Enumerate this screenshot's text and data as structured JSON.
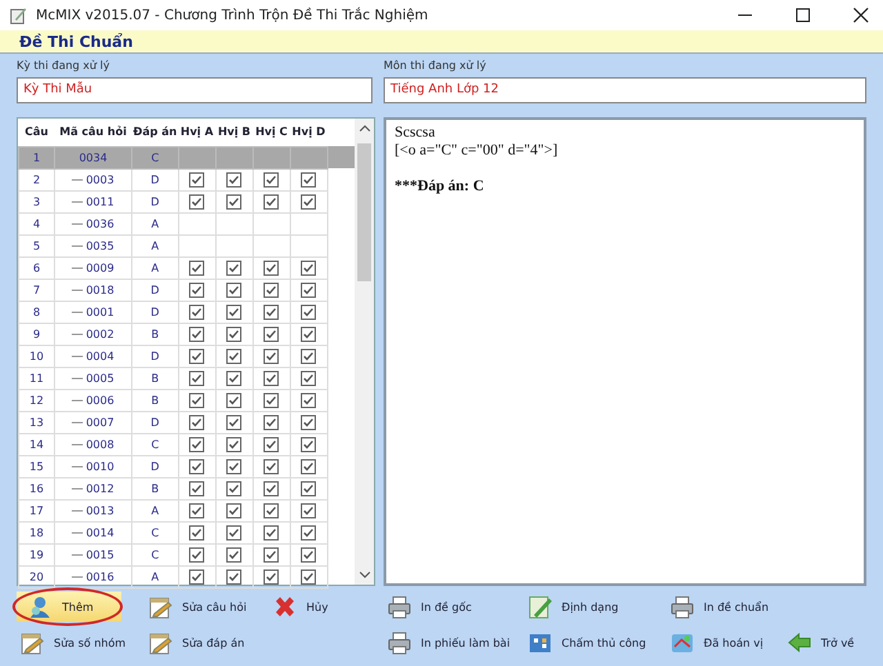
{
  "window": {
    "title": "McMIX v2015.07 - Chương Trình Trộn Đề Thi Trắc Nghiệm"
  },
  "header": {
    "title": "Đề Thi Chuẩn"
  },
  "fields": [
    {
      "label": "Kỳ thi đang xử lý",
      "value": "Kỳ Thi Mẫu"
    },
    {
      "label": "Môn thi đang xử lý",
      "value": "Tiếng Anh Lớp 12"
    }
  ],
  "table": {
    "columns": [
      "Câu",
      "Mã câu hỏi",
      "Đáp án",
      "Hvị A",
      "Hvị B",
      "Hvị C",
      "Hvị D"
    ],
    "rows": [
      {
        "no": "1",
        "code": "0034",
        "answer": "C",
        "selected": true
      },
      {
        "no": "2",
        "code": "0003",
        "answer": "D",
        "selected": false,
        "checks": [
          true,
          true,
          true,
          true
        ]
      },
      {
        "no": "3",
        "code": "0011",
        "answer": "D",
        "selected": false,
        "checks": [
          true,
          true,
          true,
          true
        ]
      },
      {
        "no": "4",
        "code": "0036",
        "answer": "A",
        "selected": false
      },
      {
        "no": "5",
        "code": "0035",
        "answer": "A",
        "selected": false
      },
      {
        "no": "6",
        "code": "0009",
        "answer": "A",
        "selected": false,
        "checks": [
          true,
          true,
          true,
          true
        ]
      },
      {
        "no": "7",
        "code": "0018",
        "answer": "D",
        "selected": false,
        "checks": [
          true,
          true,
          true,
          true
        ]
      },
      {
        "no": "8",
        "code": "0001",
        "answer": "D",
        "selected": false,
        "checks": [
          true,
          true,
          true,
          true
        ]
      },
      {
        "no": "9",
        "code": "0002",
        "answer": "B",
        "selected": false,
        "checks": [
          true,
          true,
          true,
          true
        ]
      },
      {
        "no": "10",
        "code": "0004",
        "answer": "D",
        "selected": false,
        "checks": [
          true,
          true,
          true,
          true
        ]
      },
      {
        "no": "11",
        "code": "0005",
        "answer": "B",
        "selected": false,
        "checks": [
          true,
          true,
          true,
          true
        ]
      },
      {
        "no": "12",
        "code": "0006",
        "answer": "B",
        "selected": false,
        "checks": [
          true,
          true,
          true,
          true
        ]
      },
      {
        "no": "13",
        "code": "0007",
        "answer": "D",
        "selected": false,
        "checks": [
          true,
          true,
          true,
          true
        ]
      },
      {
        "no": "14",
        "code": "0008",
        "answer": "C",
        "selected": false,
        "checks": [
          true,
          true,
          true,
          true
        ]
      },
      {
        "no": "15",
        "code": "0010",
        "answer": "D",
        "selected": false,
        "checks": [
          true,
          true,
          true,
          true
        ]
      },
      {
        "no": "16",
        "code": "0012",
        "answer": "B",
        "selected": false,
        "checks": [
          true,
          true,
          true,
          true
        ]
      },
      {
        "no": "17",
        "code": "0013",
        "answer": "A",
        "selected": false,
        "checks": [
          true,
          true,
          true,
          true
        ]
      },
      {
        "no": "18",
        "code": "0014",
        "answer": "C",
        "selected": false,
        "checks": [
          true,
          true,
          true,
          true
        ]
      },
      {
        "no": "19",
        "code": "0015",
        "answer": "C",
        "selected": false,
        "checks": [
          true,
          true,
          true,
          true
        ]
      },
      {
        "no": "20",
        "code": "0016",
        "answer": "A",
        "selected": false,
        "checks": [
          true,
          true,
          true,
          true
        ]
      }
    ]
  },
  "preview": {
    "lines": [
      {
        "kind": "text",
        "text": "Scscsa"
      },
      {
        "kind": "text",
        "text": "[<o a=\"C\" c=\"00\" d=\"4\">]"
      },
      {
        "kind": "blank"
      },
      {
        "kind": "answer",
        "text": "***Đáp án: C"
      }
    ]
  },
  "toolbar": [
    [
      {
        "label": "Thêm",
        "kind": "add",
        "highlighted": true
      },
      {
        "label": "Sửa số nhóm",
        "kind": "edit",
        "highlighted": false
      }
    ],
    [
      {
        "label": "Sửa câu hỏi",
        "kind": "edit",
        "highlighted": false
      },
      {
        "label": "Sửa đáp án",
        "kind": "edit",
        "highlighted": false
      }
    ],
    [
      {
        "label": "Hủy",
        "kind": "delete",
        "highlighted": false
      }
    ],
    [
      {
        "label": "In đề gốc",
        "kind": "print",
        "highlighted": false
      },
      {
        "label": "In phiếu làm bài",
        "kind": "print",
        "highlighted": false
      }
    ],
    [
      {
        "label": "Định dạng",
        "kind": "format",
        "highlighted": false
      },
      {
        "label": "Chấm thủ công",
        "kind": "grade",
        "highlighted": false
      }
    ],
    [
      {
        "label": "In đề chuẩn",
        "kind": "print",
        "highlighted": false
      },
      {
        "label": "Đã hoán vị",
        "kind": "shuffle",
        "highlighted": false
      }
    ],
    [
      {
        "label": "Trở về",
        "kind": "back",
        "highlighted": false
      }
    ]
  ]
}
